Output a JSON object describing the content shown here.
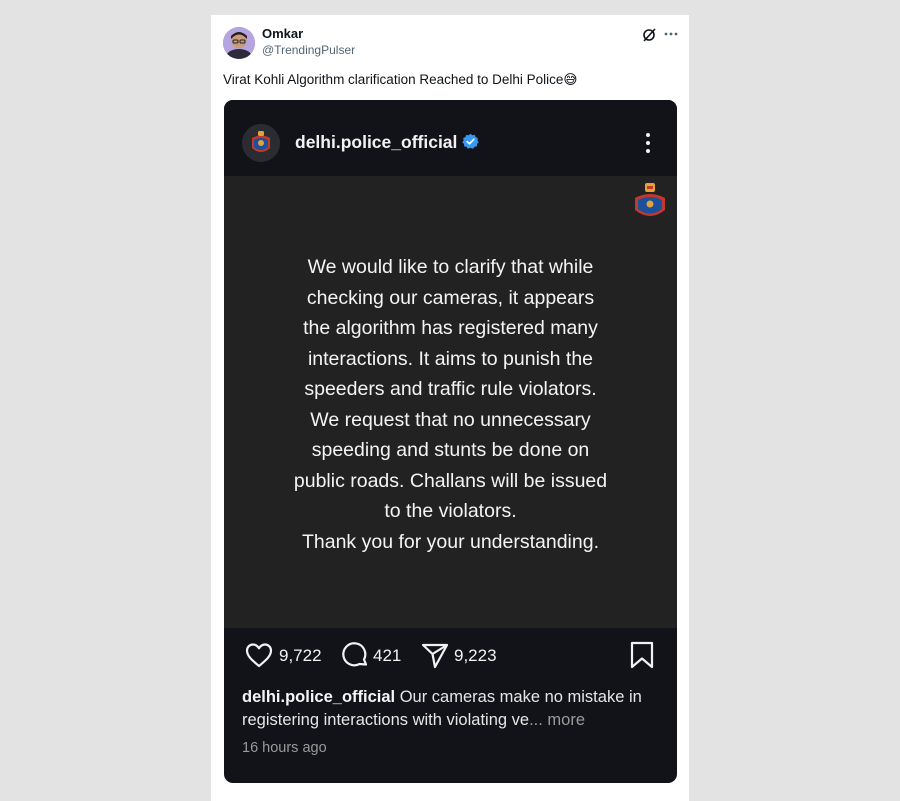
{
  "tweet": {
    "author_name": "Omkar",
    "author_handle": "@TrendingPulser",
    "text": "Virat Kohli Algorithm clarification Reached to Delhi Police😅"
  },
  "instagram": {
    "username": "delhi.police_official",
    "post_lines": [
      "We would like to clarify that while",
      "checking our cameras, it appears",
      "the algorithm has registered many",
      "interactions. It aims to punish the",
      "speeders and traffic rule violators.",
      "We request that no unnecessary",
      "speeding and stunts be done on",
      "public roads. Challans will be issued",
      "to the violators.",
      "Thank you for your understanding."
    ],
    "likes": "9,722",
    "comments": "421",
    "shares": "9,223",
    "caption_user": "delhi.police_official",
    "caption_line1": " Our cameras make no mistake in",
    "caption_line2": "registering interactions with violating ve",
    "caption_more": "... more",
    "timestamp": "16 hours ago"
  },
  "icons": [
    "grok-icon",
    "more-icon",
    "verified-icon",
    "kebab-icon",
    "heart-icon",
    "comment-icon",
    "share-icon",
    "bookmark-icon"
  ],
  "colors": {
    "card_bg": "#111318",
    "post_bg": "#222222",
    "verified": "#3897f0",
    "page_bg": "#e3e3e3"
  }
}
